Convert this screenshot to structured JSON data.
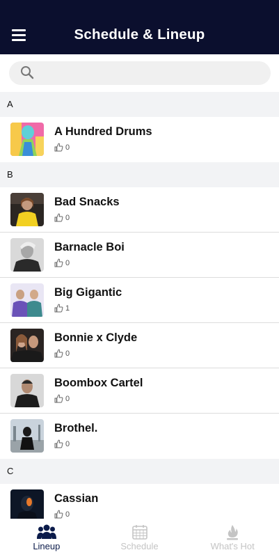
{
  "header": {
    "title": "Schedule & Lineup",
    "menu_icon": "hamburger-menu-icon"
  },
  "search": {
    "placeholder": "",
    "value": "",
    "icon": "search-icon"
  },
  "sections": [
    {
      "letter": "A",
      "artists": [
        {
          "name": "A Hundred Drums",
          "likes": "0"
        }
      ]
    },
    {
      "letter": "B",
      "artists": [
        {
          "name": "Bad Snacks",
          "likes": "0"
        },
        {
          "name": "Barnacle Boi",
          "likes": "0"
        },
        {
          "name": "Big Gigantic",
          "likes": "1"
        },
        {
          "name": "Bonnie x Clyde",
          "likes": "0"
        },
        {
          "name": "Boombox Cartel",
          "likes": "0"
        },
        {
          "name": "Brothel.",
          "likes": "0"
        }
      ]
    },
    {
      "letter": "C",
      "artists": [
        {
          "name": "Cassian",
          "likes": "0"
        }
      ]
    }
  ],
  "tabs": [
    {
      "label": "Lineup",
      "icon": "users-icon",
      "active": true
    },
    {
      "label": "Schedule",
      "icon": "calendar-icon",
      "active": false
    },
    {
      "label": "What's Hot",
      "icon": "flame-icon",
      "active": false
    }
  ],
  "colors": {
    "header_bg": "#0b0f2e",
    "active_tab": "#0b1b4a",
    "inactive_tab": "#c4c4c4",
    "section_bg": "#f2f3f5"
  }
}
